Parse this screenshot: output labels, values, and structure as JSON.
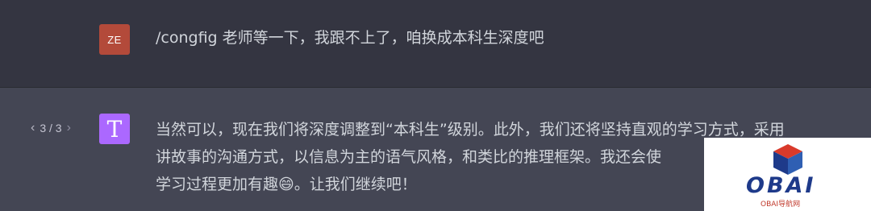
{
  "user_message": {
    "avatar_initials": "ZE",
    "avatar_color": "#b34a3a",
    "text": "/congfig 老师等一下，我跟不上了，咱换成本科生深度吧"
  },
  "assistant_message": {
    "avatar_letter": "T",
    "avatar_color": "#ab68ff",
    "pager": {
      "prev_icon": "chevron-left-icon",
      "counter": "3 / 3",
      "next_icon": "chevron-right-icon"
    },
    "lines": [
      "当然可以，现在我们将深度调整到“本科生”级别。此外，我们还将坚持直观的学习方式，采用",
      "讲故事的沟通方式，以信息为主的语气风格，和类比的推理框架。我还会使",
      "学习过程更加有趣😄。让我们继续吧！"
    ]
  },
  "watermark": {
    "brand": "OBAI",
    "subtitle": "OBAI导航网"
  }
}
